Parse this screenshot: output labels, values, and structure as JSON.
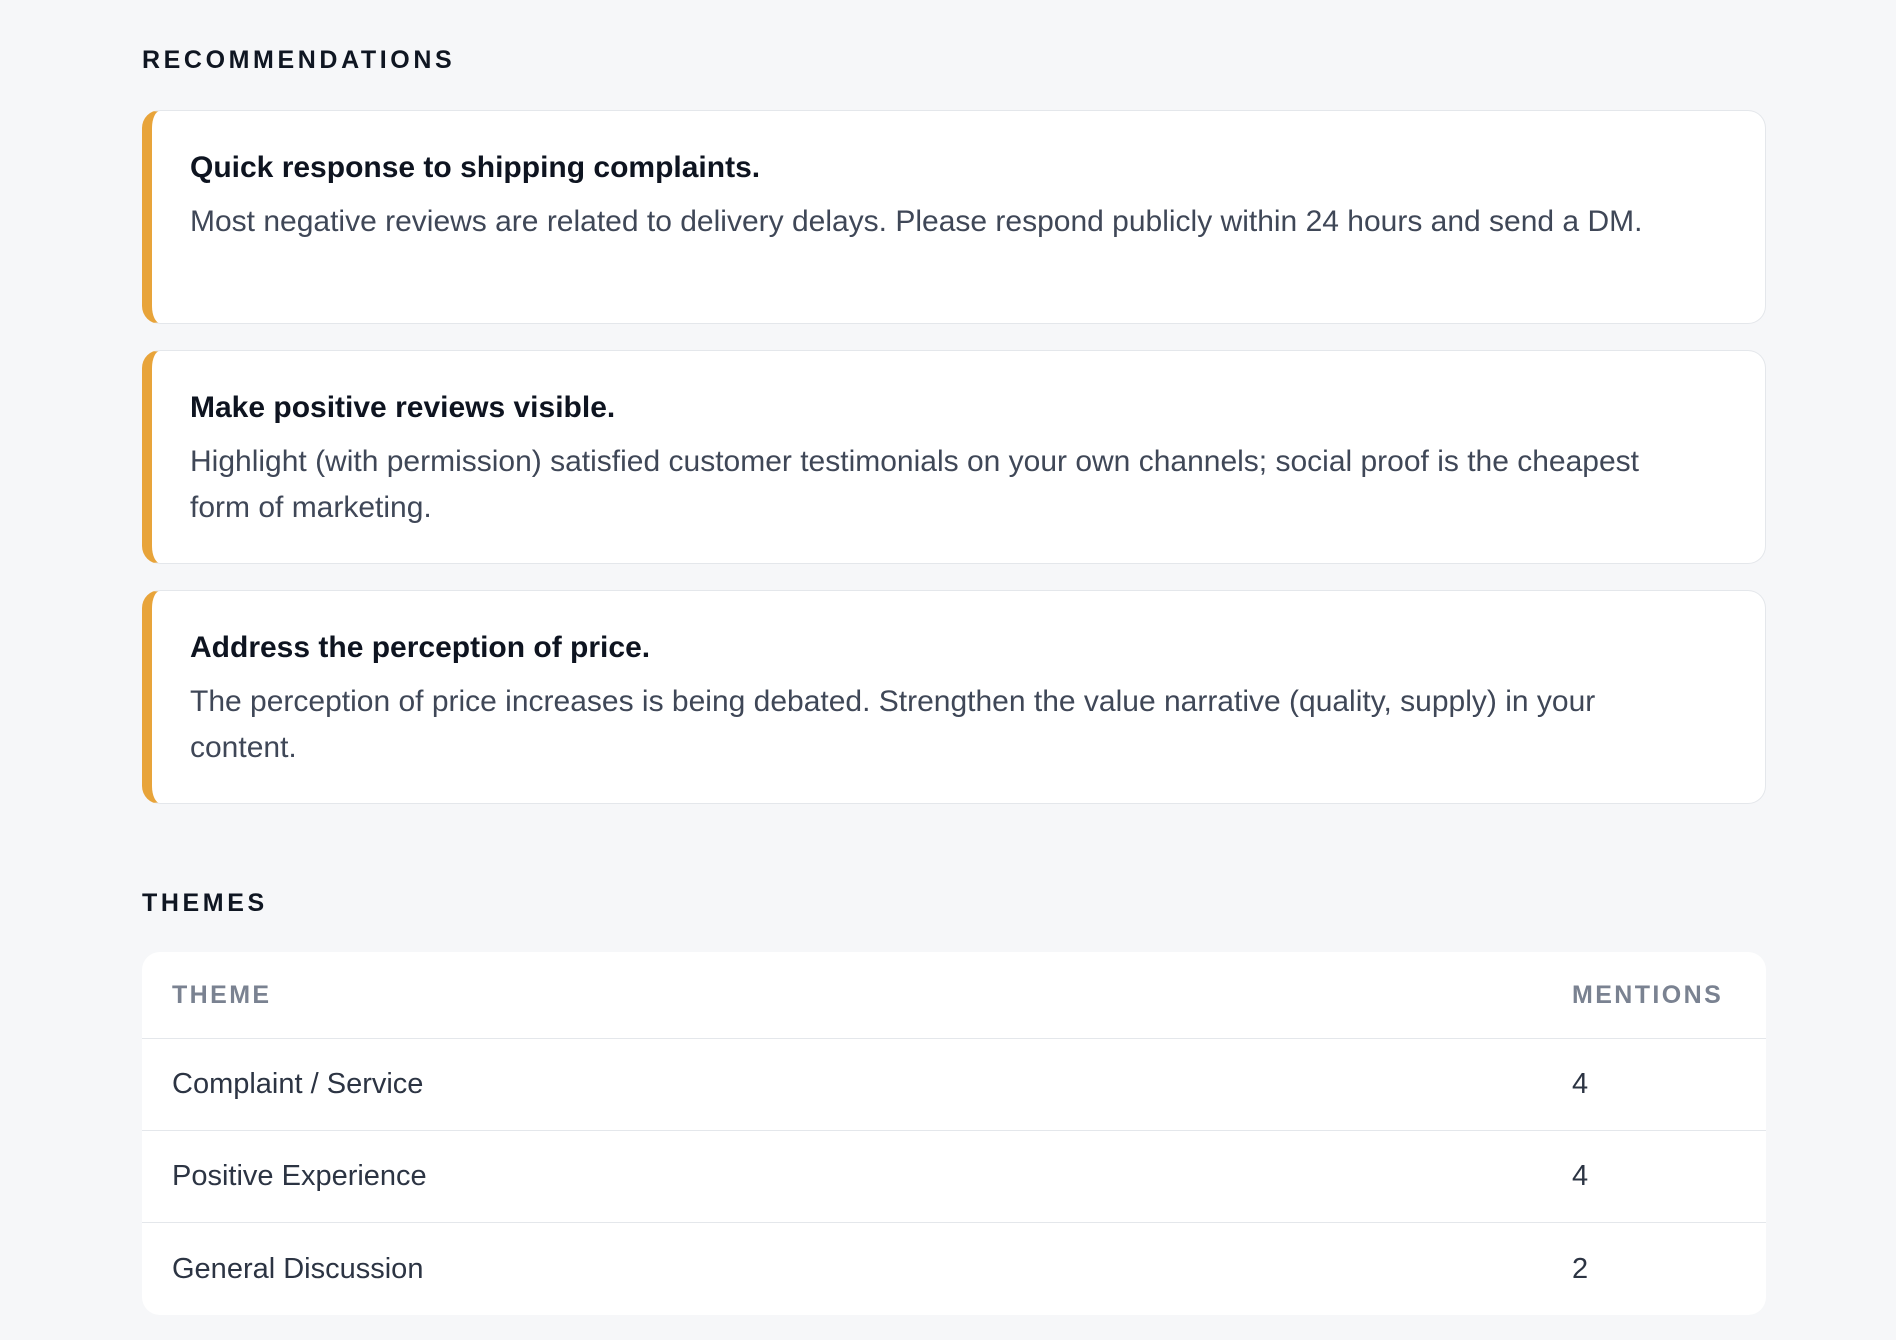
{
  "recommendations": {
    "title": "RECOMMENDATIONS",
    "accent_color": "#e8a43a",
    "items": [
      {
        "heading": "Quick response to shipping complaints.",
        "body": "Most negative reviews are related to delivery delays. Please respond publicly within 24 hours and send a DM."
      },
      {
        "heading": "Make positive reviews visible.",
        "body": "Highlight (with permission) satisfied customer testimonials on your own channels; social proof is the cheapest form of marketing."
      },
      {
        "heading": "Address the perception of price.",
        "body": "The perception of price increases is being debated. Strengthen the value narrative (quality, supply) in your content."
      }
    ]
  },
  "themes": {
    "title": "THEMES",
    "columns": {
      "theme": "THEME",
      "mentions": "MENTIONS"
    },
    "rows": [
      {
        "theme": "Complaint / Service",
        "mentions": "4"
      },
      {
        "theme": "Positive Experience",
        "mentions": "4"
      },
      {
        "theme": "General Discussion",
        "mentions": "2"
      }
    ]
  }
}
